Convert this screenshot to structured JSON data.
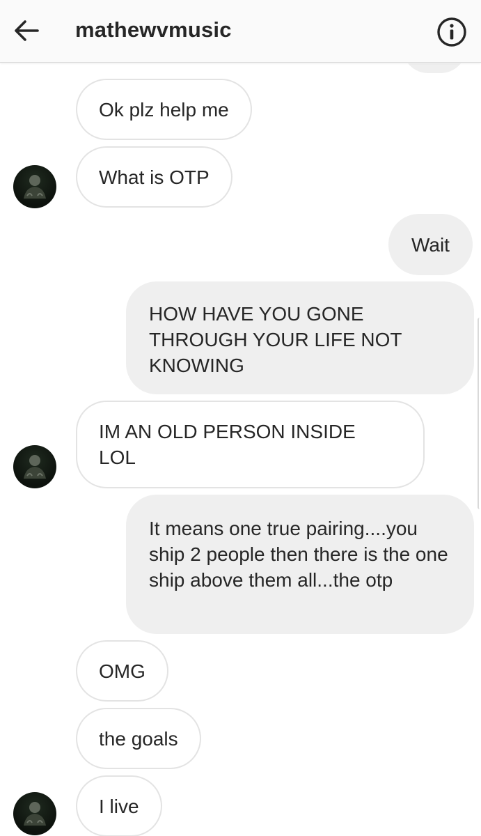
{
  "header": {
    "title": "mathewvmusic",
    "back_icon": "arrow-left-icon",
    "info_icon": "info-circle-icon"
  },
  "messages": [
    {
      "from": "them",
      "text": "Ok plz help me"
    },
    {
      "from": "them",
      "text": "What is OTP"
    },
    {
      "from": "me",
      "text": "Wait"
    },
    {
      "from": "me",
      "text": "HOW HAVE YOU GONE THROUGH YOUR LIFE NOT KNOWING"
    },
    {
      "from": "them",
      "text": "IM AN OLD PERSON INSIDE LOL"
    },
    {
      "from": "me",
      "text": "It means one true pairing....you ship 2 people then there is the one ship above them all...the otp"
    },
    {
      "from": "them",
      "text": "OMG"
    },
    {
      "from": "them",
      "text": "the goals"
    },
    {
      "from": "them",
      "text": "I live"
    }
  ],
  "colors": {
    "incoming_bubble_border": "#e3e3e3",
    "outgoing_bubble_bg": "#efefef",
    "text": "#262626",
    "header_bg": "#fafafa"
  }
}
